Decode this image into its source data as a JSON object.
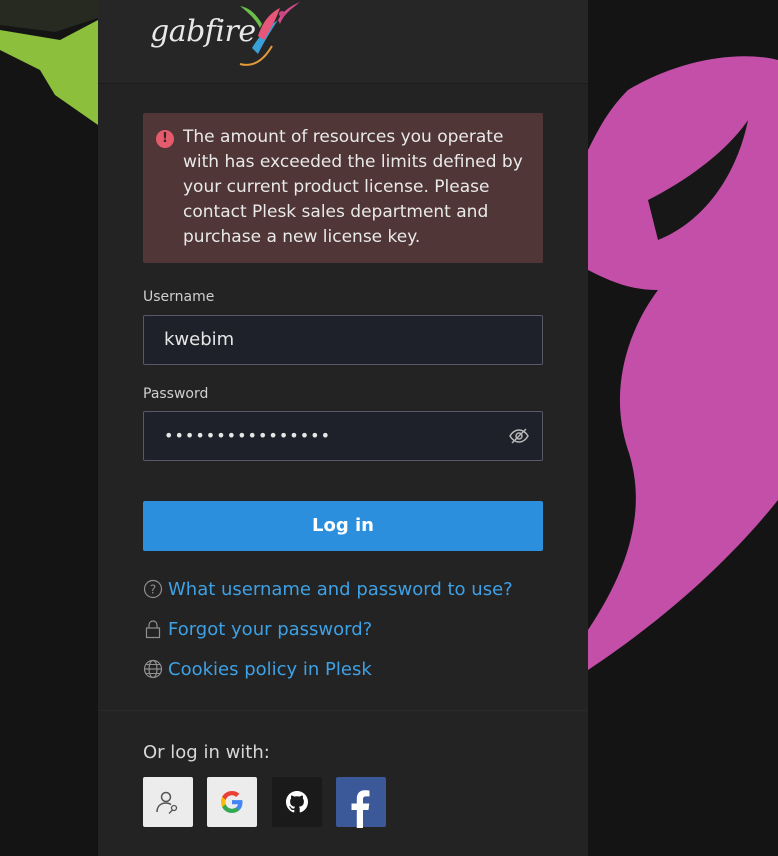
{
  "brand": {
    "name": "gabfire"
  },
  "alert": {
    "icon": "exclamation-icon",
    "message": "The amount of resources you operate with has exceeded the limits defined by your current product license. Please contact Plesk sales department and purchase a new license key."
  },
  "form": {
    "username_label": "Username",
    "username_value": "kwebim",
    "password_label": "Password",
    "password_value": "••••••••••••••••",
    "login_button": "Log in"
  },
  "links": [
    {
      "icon": "question-circle-icon",
      "label": "What username and password to use?"
    },
    {
      "icon": "lock-icon",
      "label": "Forgot your password?"
    },
    {
      "icon": "globe-icon",
      "label": "Cookies policy in Plesk"
    }
  ],
  "social": {
    "label": "Or log in with:",
    "providers": [
      {
        "icon": "user-key-icon"
      },
      {
        "icon": "google-icon"
      },
      {
        "icon": "github-icon"
      },
      {
        "icon": "facebook-icon"
      }
    ]
  },
  "colors": {
    "accent": "#2b8fde",
    "link": "#3ea1e6",
    "alert_bg": "#503637",
    "alert_icon": "#e35b6d",
    "panel_bg": "#232323",
    "input_bg": "#1e2129"
  }
}
